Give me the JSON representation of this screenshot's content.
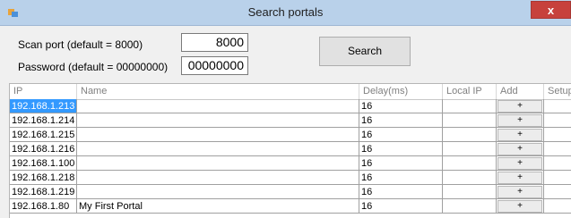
{
  "window": {
    "title": "Search portals",
    "close_label": "x"
  },
  "form": {
    "scan_port_label": "Scan port (default = 8000)",
    "scan_port_value": "8000",
    "password_label": "Password (default = 00000000)",
    "password_value": "00000000",
    "search_label": "Search"
  },
  "table": {
    "headers": [
      "IP",
      "Name",
      "Delay(ms)",
      "Local IP",
      "Add",
      "Setup"
    ],
    "add_label": "+",
    "rows": [
      {
        "ip": "192.168.1.213",
        "name": "",
        "delay": "16",
        "local_ip": ""
      },
      {
        "ip": "192.168.1.214",
        "name": "",
        "delay": "16",
        "local_ip": ""
      },
      {
        "ip": "192.168.1.215",
        "name": "",
        "delay": "16",
        "local_ip": ""
      },
      {
        "ip": "192.168.1.216",
        "name": "",
        "delay": "16",
        "local_ip": ""
      },
      {
        "ip": "192.168.1.100",
        "name": "",
        "delay": "16",
        "local_ip": ""
      },
      {
        "ip": "192.168.1.218",
        "name": "",
        "delay": "16",
        "local_ip": ""
      },
      {
        "ip": "192.168.1.219",
        "name": "",
        "delay": "16",
        "local_ip": ""
      },
      {
        "ip": "192.168.1.80",
        "name": "My First Portal",
        "delay": "16",
        "local_ip": ""
      }
    ]
  }
}
